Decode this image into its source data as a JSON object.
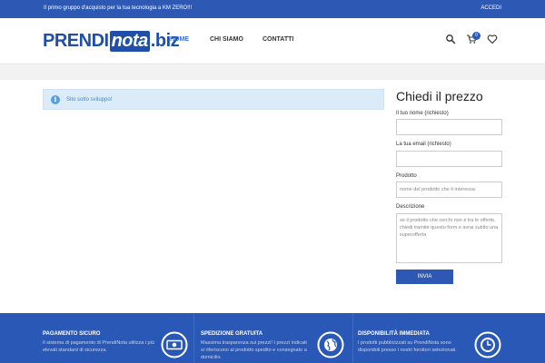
{
  "topbar": {
    "promo": "Il primo gruppo d'acquisto per la tua tecnologia a KM ZERO!!!",
    "login": "ACCEDI"
  },
  "header": {
    "logo": {
      "part1": "PRENDI",
      "part2": "nota",
      "part3": ".biz"
    },
    "nav": [
      {
        "label": "HOME",
        "active": true
      },
      {
        "label": "CHI SIAMO",
        "active": false
      },
      {
        "label": "CONTATTI",
        "active": false
      }
    ],
    "icons": [
      "search-icon",
      "cart-icon",
      "heart-icon"
    ],
    "cart_count": "0"
  },
  "notice": {
    "icon": "info-icon",
    "text": "Sito sotto sviluppo!"
  },
  "form": {
    "title": "Chiedi il prezzo",
    "name_label": "Il tuo nome (richiesto)",
    "email_label": "La tua email (richiesto)",
    "product_label": "Prodotto",
    "product_placeholder": "nome del prodotto che ti interessa",
    "description_label": "Descrizione",
    "description_placeholder": "se il prodotto che cerchi non è tra le offerte, chiedi tramite questo form e avrai subito una superofferta",
    "submit_label": "INVIA"
  },
  "footer": {
    "features": [
      {
        "title": "PAGAMENTO SICURO",
        "desc": "Il sistema di pagamento di PrendiNota utilizza i più elevati standard di sicurezza.",
        "icon": "money-icon"
      },
      {
        "title": "SPEDIZIONE GRATUITA",
        "desc": "Massima trasparenza sui prezzi! I prezzi indicati si riferiscono al prodotto spedito e consegnato a domicilio.",
        "icon": "globe-icon"
      },
      {
        "title": "DISPONIBILITÀ IMMEDIATA",
        "desc": "I prodotti pubblicizzati su PrendiNota sono disponibili presso i nostri fornitori selezionati.",
        "icon": "clock-icon"
      }
    ]
  },
  "colors": {
    "brand_blue": "#2d59b5",
    "nav_active": "#3d6fd0",
    "notice_bg": "#dcebf8"
  }
}
